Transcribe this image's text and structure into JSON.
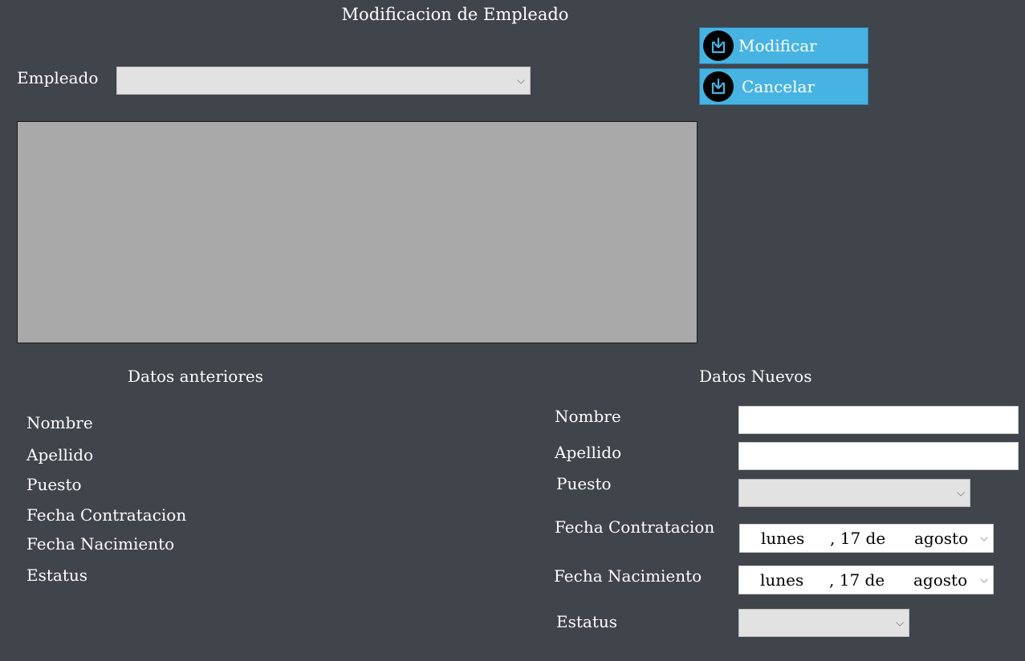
{
  "title": "Modificacion de Empleado",
  "employee": {
    "label": "Empleado",
    "value": ""
  },
  "buttons": {
    "modify": "Modificar",
    "cancel": "Cancelar"
  },
  "old_data": {
    "header": "Datos anteriores",
    "labels": [
      "Nombre",
      "Apellido",
      "Puesto",
      "Fecha Contratacion",
      "Fecha Nacimiento",
      "Estatus"
    ]
  },
  "new_data": {
    "header": "Datos Nuevos",
    "nombre": {
      "label": "Nombre",
      "value": ""
    },
    "apellido": {
      "label": "Apellido",
      "value": ""
    },
    "puesto": {
      "label": "Puesto",
      "value": ""
    },
    "fecha_contratacion": {
      "label": "Fecha Contratacion",
      "weekday": "lunes",
      "day": ", 17 de",
      "month": "agosto"
    },
    "fecha_nacimiento": {
      "label": "Fecha Nacimiento",
      "weekday": "lunes",
      "day": ", 17 de",
      "month": "agosto"
    },
    "estatus": {
      "label": "Estatus",
      "value": ""
    }
  },
  "colors": {
    "background": "#40444b",
    "button": "#47b3e3",
    "grid": "#a9a9a9"
  }
}
